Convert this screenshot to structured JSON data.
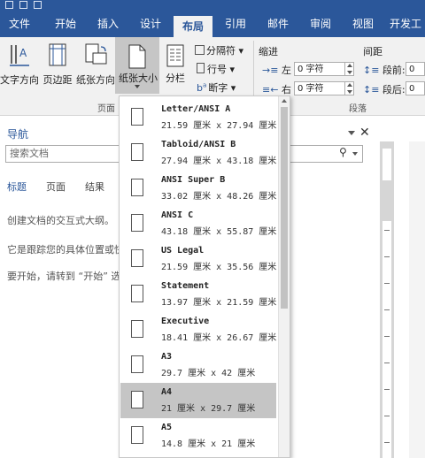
{
  "menu": {
    "tabs": [
      {
        "label": "文件"
      },
      {
        "label": "开始"
      },
      {
        "label": "插入"
      },
      {
        "label": "设计"
      },
      {
        "label": "布局"
      },
      {
        "label": "引用"
      },
      {
        "label": "邮件"
      },
      {
        "label": "审阅"
      },
      {
        "label": "视图"
      },
      {
        "label": "开发工"
      }
    ],
    "active_tab": "布局"
  },
  "ribbon": {
    "text_direction": "文字方向",
    "margins": "页边距",
    "orientation": "纸张方向",
    "paper_size": "纸张大小",
    "columns": "分栏",
    "breaks": "分隔符",
    "line_numbers": "行号",
    "hyphenation": "断字",
    "group_page_setup": "页面",
    "indent_label": "缩进",
    "indent_left": "左",
    "indent_left_value": "0 字符",
    "indent_right": "右",
    "indent_right_value": "0 字符",
    "spacing_label": "间距",
    "spacing_before": "段前:",
    "spacing_before_value": "0",
    "spacing_after": "段后:",
    "spacing_after_value": "0",
    "group_paragraph": "段落"
  },
  "nav": {
    "title": "导航",
    "search_placeholder": "搜索文档",
    "tabs": [
      {
        "label": "标题"
      },
      {
        "label": "页面"
      },
      {
        "label": "结果"
      }
    ],
    "lines": [
      "创建文档的交互式大纲。",
      "它是跟踪您的具体位置或快",
      "要开始，请转到 “开始” 选"
    ]
  },
  "paper_sizes": {
    "items": [
      {
        "name": "Letter/ANSI A",
        "dims": "21.59 厘米 x 27.94 厘米",
        "selected": false
      },
      {
        "name": "Tabloid/ANSI B",
        "dims": "27.94 厘米 x 43.18 厘米",
        "selected": false
      },
      {
        "name": "ANSI Super B",
        "dims": "33.02 厘米 x 48.26 厘米",
        "selected": false
      },
      {
        "name": "ANSI C",
        "dims": "43.18 厘米 x 55.87 厘米",
        "selected": false
      },
      {
        "name": "US Legal",
        "dims": "21.59 厘米 x 35.56 厘米",
        "selected": false
      },
      {
        "name": "Statement",
        "dims": "13.97 厘米 x 21.59 厘米",
        "selected": false
      },
      {
        "name": "Executive",
        "dims": "18.41 厘米 x 26.67 厘米",
        "selected": false
      },
      {
        "name": "A3",
        "dims": "29.7 厘米 x 42 厘米",
        "selected": false
      },
      {
        "name": "A4",
        "dims": "21 厘米 x 29.7 厘米",
        "selected": true
      },
      {
        "name": "A5",
        "dims": "14.8 厘米 x 21 厘米",
        "selected": false
      }
    ]
  },
  "colors": {
    "brand": "#2b579a",
    "selected_item": "#c5c5c5"
  },
  "icons": {
    "close": "close-icon",
    "search": "search-icon"
  }
}
